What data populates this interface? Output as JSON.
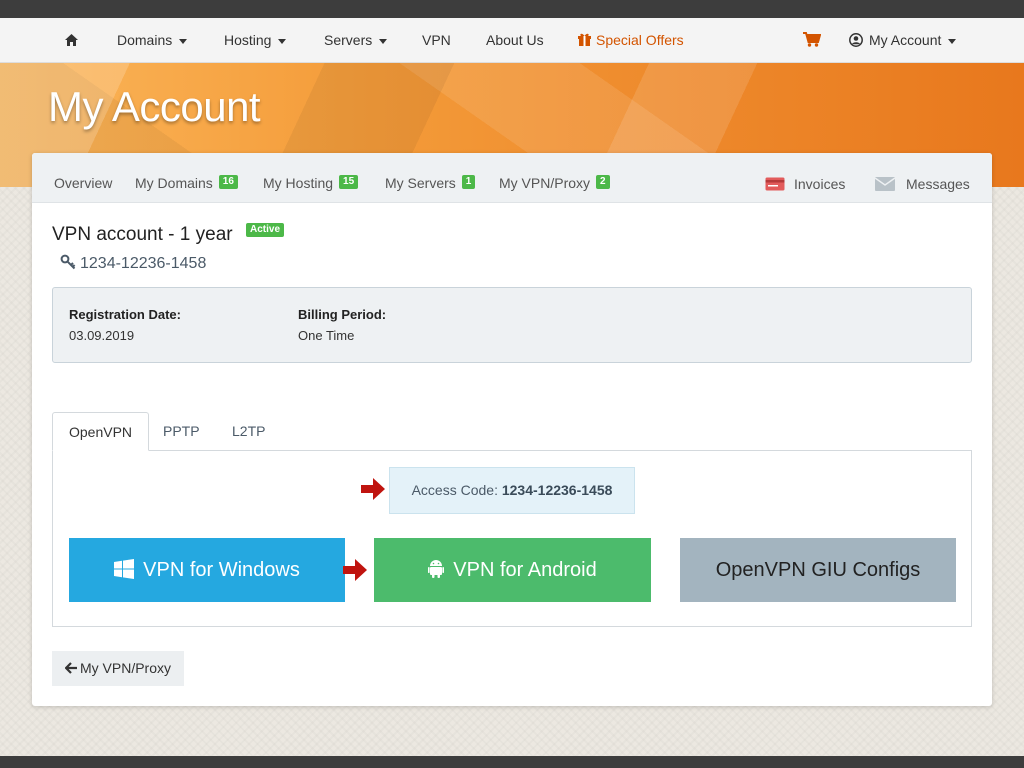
{
  "colors": {
    "accent_orange": "#d35400",
    "badge_green": "#4cb848",
    "windows_blue": "#25a8e0",
    "android_green": "#4cbb6c",
    "configs_gray": "#a3b4bf",
    "arrow_red": "#c0140f"
  },
  "navbar": {
    "home_icon": "home-icon",
    "items": [
      {
        "label": "Domains",
        "dropdown": true
      },
      {
        "label": "Hosting",
        "dropdown": true
      },
      {
        "label": "Servers",
        "dropdown": true
      },
      {
        "label": "VPN",
        "dropdown": false
      },
      {
        "label": "About Us",
        "dropdown": false
      }
    ],
    "special_offers": {
      "label": "Special Offers",
      "icon": "gift-icon"
    },
    "cart_icon": "cart-icon",
    "account": {
      "label": "My Account",
      "icon": "user-circle-icon",
      "dropdown": true
    }
  },
  "hero": {
    "title": "My Account"
  },
  "card_nav": {
    "items": [
      {
        "label": "Overview"
      },
      {
        "label": "My Domains",
        "badge": "16"
      },
      {
        "label": "My Hosting",
        "badge": "15"
      },
      {
        "label": "My Servers",
        "badge": "1"
      },
      {
        "label": "My VPN/Proxy",
        "badge": "2"
      }
    ],
    "invoices": {
      "label": "Invoices",
      "icon": "invoice-icon"
    },
    "messages": {
      "label": "Messages",
      "icon": "envelope-icon"
    }
  },
  "account": {
    "title": "VPN account - 1 year",
    "status": "Active",
    "id_icon": "key-icon",
    "id": "1234-12236-1458",
    "registration_label": "Registration Date:",
    "registration_value": "03.09.2019",
    "billing_label": "Billing Period:",
    "billing_value": "One Time"
  },
  "tabs": {
    "items": [
      "OpenVPN",
      "PPTP",
      "L2TP"
    ],
    "active": "OpenVPN"
  },
  "access": {
    "label": "Access Code:",
    "code": "1234-12236-1458"
  },
  "buttons": {
    "windows": {
      "label": "VPN for Windows",
      "icon": "windows-icon"
    },
    "android": {
      "label": "VPN for Android",
      "icon": "android-icon"
    },
    "configs": {
      "label": "OpenVPN GIU Configs"
    }
  },
  "back": {
    "label": "My VPN/Proxy",
    "icon": "arrow-left-icon"
  }
}
